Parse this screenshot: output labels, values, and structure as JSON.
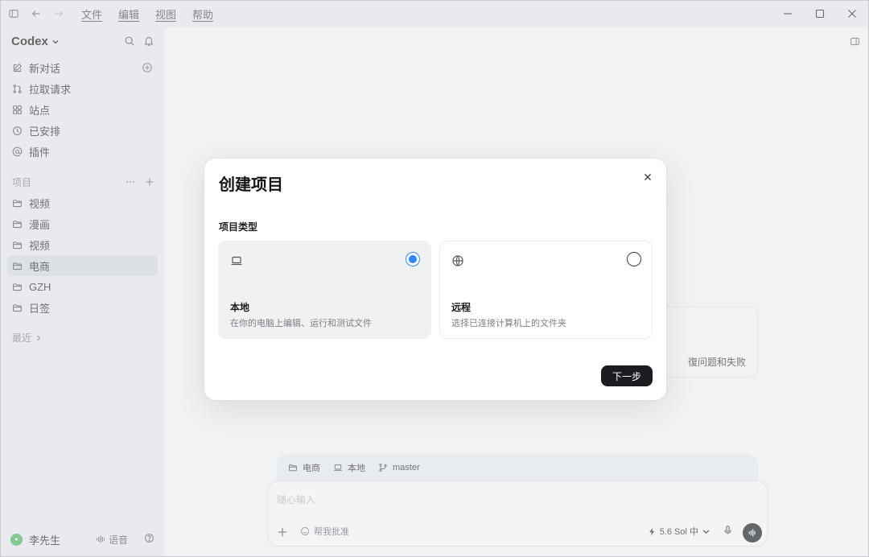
{
  "menu": [
    "文件",
    "编辑",
    "视图",
    "帮助"
  ],
  "sidebar": {
    "brand": "Codex",
    "nav": [
      {
        "label": "新对话",
        "icon": "edit-icon"
      },
      {
        "label": "拉取请求",
        "icon": "pull-request-icon"
      },
      {
        "label": "站点",
        "icon": "grid-icon"
      },
      {
        "label": "已安排",
        "icon": "clock-icon"
      },
      {
        "label": "插件",
        "icon": "at-icon"
      }
    ],
    "projects_title": "项目",
    "projects": [
      "视频",
      "漫画",
      "视频",
      "电商",
      "GZH",
      "日签"
    ],
    "active_project_index": 3,
    "recent_label": "最近",
    "user_name": "李先生",
    "voice_label": "语音"
  },
  "main": {
    "bg_card_text": "復问题和失败",
    "context": {
      "folder": "电商",
      "env": "本地",
      "branch": "master"
    },
    "composer_placeholder": "随心输入",
    "approve_label": "帮我批准",
    "model_label": "5.6 Sol 中"
  },
  "modal": {
    "title": "创建项目",
    "section_label": "项目类型",
    "options": [
      {
        "title": "本地",
        "description": "在你的电脑上编辑、运行和测试文件",
        "selected": true
      },
      {
        "title": "远程",
        "description": "选择已连接计算机上的文件夹",
        "selected": false
      }
    ],
    "next_label": "下一步"
  },
  "colors": {
    "accent": "#2f86f5",
    "primary_button": "#1a1c1f",
    "avatar": "#4db35e"
  }
}
